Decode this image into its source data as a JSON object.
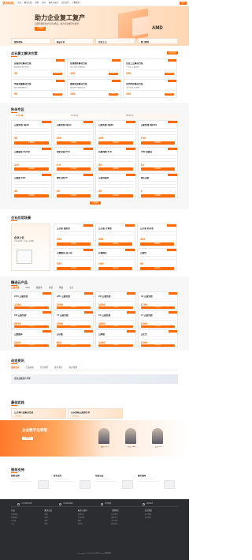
{
  "nav": {
    "logo": "京东科技",
    "items": [
      "产品",
      "解决方案",
      "场景",
      "定价",
      "服务与支持",
      "合作伙伴",
      "了解我们"
    ],
    "login": "登录"
  },
  "hero": {
    "title": "助力企业复工复产",
    "subtitle": "云服务器新用户专享1折起，助力企业数字化转型",
    "button": "立即抢购",
    "brand": "AMD",
    "promos": [
      "限时秒杀",
      "新品专享",
      "企业上云",
      "热门推荐"
    ]
  },
  "solutions": {
    "title": "企业复工解决方案",
    "button": "查看详情",
    "cards": [
      {
        "title": "远程办公解决方案",
        "desc": "高效远程协同办公",
        "price": "99",
        "btn": "立即购买"
      },
      {
        "title": "在线教育解决方案",
        "desc": "稳定流畅在线课堂",
        "price": "199",
        "btn": "立即购买"
      },
      {
        "title": "企业上云解决方案",
        "desc": "一站式上云迁移",
        "price": "299",
        "btn": "立即购买"
      },
      {
        "title": "电商直播解决方案",
        "desc": "高并发直播带货",
        "price": "99",
        "btn": "立即购买"
      },
      {
        "title": "视频会议解决方案",
        "desc": "高清多人视频会议",
        "price": "199",
        "btn": "立即购买"
      },
      {
        "title": "安全防护解决方案",
        "desc": "全方位安全保障",
        "price": "299",
        "btn": "立即购买"
      }
    ]
  },
  "flash": {
    "title": "秒杀专区",
    "tabs": [
      "10:00 场",
      "14:00 场",
      "20:00 场"
    ],
    "more": "查看更多",
    "items": [
      {
        "name": "云服务器 1核2G",
        "price": "99",
        "btn": "立即抢购"
      },
      {
        "name": "云服务器 2核4G",
        "price": "199",
        "btn": "立即抢购"
      },
      {
        "name": "云服务器 4核8G",
        "price": "399",
        "btn": "立即抢购"
      },
      {
        "name": "云服务器 8核16G",
        "price": "799",
        "btn": "立即抢购"
      },
      {
        "name": "云数据库 MySQL",
        "price": "129",
        "btn": "立即抢购"
      },
      {
        "name": "对象存储 OSS",
        "price": "9.9",
        "btn": "立即抢购"
      },
      {
        "name": "负载均衡 SLB",
        "price": "59",
        "btn": "立即抢购"
      },
      {
        "name": "CDN 流量包",
        "price": "19",
        "btn": "立即抢购"
      },
      {
        "name": "云硬盘 SSD",
        "price": "39",
        "btn": "立即抢购"
      },
      {
        "name": "弹性公网 IP",
        "price": "29",
        "btn": "立即抢购"
      },
      {
        "name": "云监控服务",
        "price": "49",
        "btn": "立即抢购"
      },
      {
        "name": "域名注册",
        "price": "1",
        "btn": "立即抢购"
      }
    ]
  },
  "enterprise": {
    "title": "企业应用场景",
    "left_title": "企业上云",
    "left_desc": "为企业提供一站式上云服务",
    "items": [
      {
        "name": "云主机 通用型",
        "price": "299",
        "btn": "立即购买"
      },
      {
        "name": "云主机 计算型",
        "price": "399",
        "btn": "立即购买"
      },
      {
        "name": "云主机 内存型",
        "price": "499",
        "btn": "立即购买"
      },
      {
        "name": "云数据库 高可用",
        "price": "599",
        "btn": "立即购买"
      },
      {
        "name": "存储网关",
        "price": "199",
        "btn": "立即购买"
      },
      {
        "name": "云备份",
        "price": "99",
        "btn": "立即购买"
      }
    ]
  },
  "featured": {
    "title": "精选云产品",
    "tabs": [
      "云服务器",
      "GPU",
      "数据库",
      "存储",
      "网络",
      "安全"
    ],
    "items": [
      {
        "name": "CPU 云服务器",
        "price": "1299"
      },
      {
        "name": "GPU 云服务器",
        "price": "2999"
      },
      {
        "name": "CD 云服务器",
        "price": "1699"
      },
      {
        "name": "CE 云服务器",
        "price": "1799"
      },
      {
        "name": "CN 云服务器",
        "price": "2099"
      },
      {
        "name": "CT 云服务器",
        "price": "1599"
      },
      {
        "name": "CS 云服务器",
        "price": "1899"
      },
      {
        "name": "CT 云服务器",
        "price": "1999"
      },
      {
        "name": "云数据库",
        "price": "2609"
      },
      {
        "name": "云存储",
        "price": "969"
      },
      {
        "name": "云网络",
        "price": "1299"
      },
      {
        "name": "云安全",
        "price": "1999"
      }
    ],
    "btn": "立即购买"
  },
  "news": {
    "title": "动态资讯",
    "links": [
      "最新活动",
      "产品动态",
      "行业资讯",
      "技术专栏",
      "客户案例"
    ],
    "banner": "京东云新用户专享"
  },
  "practice": {
    "title": "最佳实践",
    "cards": [
      {
        "title": "云计算行业解决方案",
        "sub": "了解详情"
      },
      {
        "title": "京东智联云案例分享",
        "sub": "了解详情"
      }
    ],
    "band_title": "企业数字化转型",
    "band_button": "立即咨询",
    "people": [
      "张总 CTO",
      "李总 CEO",
      "王总 CIO"
    ]
  },
  "services": {
    "title": "服务支持",
    "items": [
      "售前咨询",
      "技术支持",
      "培训认证",
      "服务保障"
    ]
  },
  "footer": {
    "features": [
      "7天无理由退款",
      "专业服务保障",
      "免费备案",
      "售后服务"
    ],
    "cols": [
      {
        "title": "产品",
        "links": [
          "云服务器",
          "云数据库",
          "云存储",
          "CDN"
        ]
      },
      {
        "title": "解决方案",
        "links": [
          "电商",
          "金融",
          "教育",
          "游戏"
        ]
      },
      {
        "title": "服务与支持",
        "links": [
          "文档中心",
          "工单系统",
          "备案",
          "控制台"
        ]
      },
      {
        "title": "了解我们",
        "links": [
          "关于我们",
          "新闻中心",
          "加入我们",
          "联系我们"
        ]
      },
      {
        "title": "关注我们",
        "links": [
          "官方微博",
          "官方微信"
        ]
      }
    ],
    "copyright": "Copyright © 2004-2020 京东JD.com 版权所有"
  }
}
